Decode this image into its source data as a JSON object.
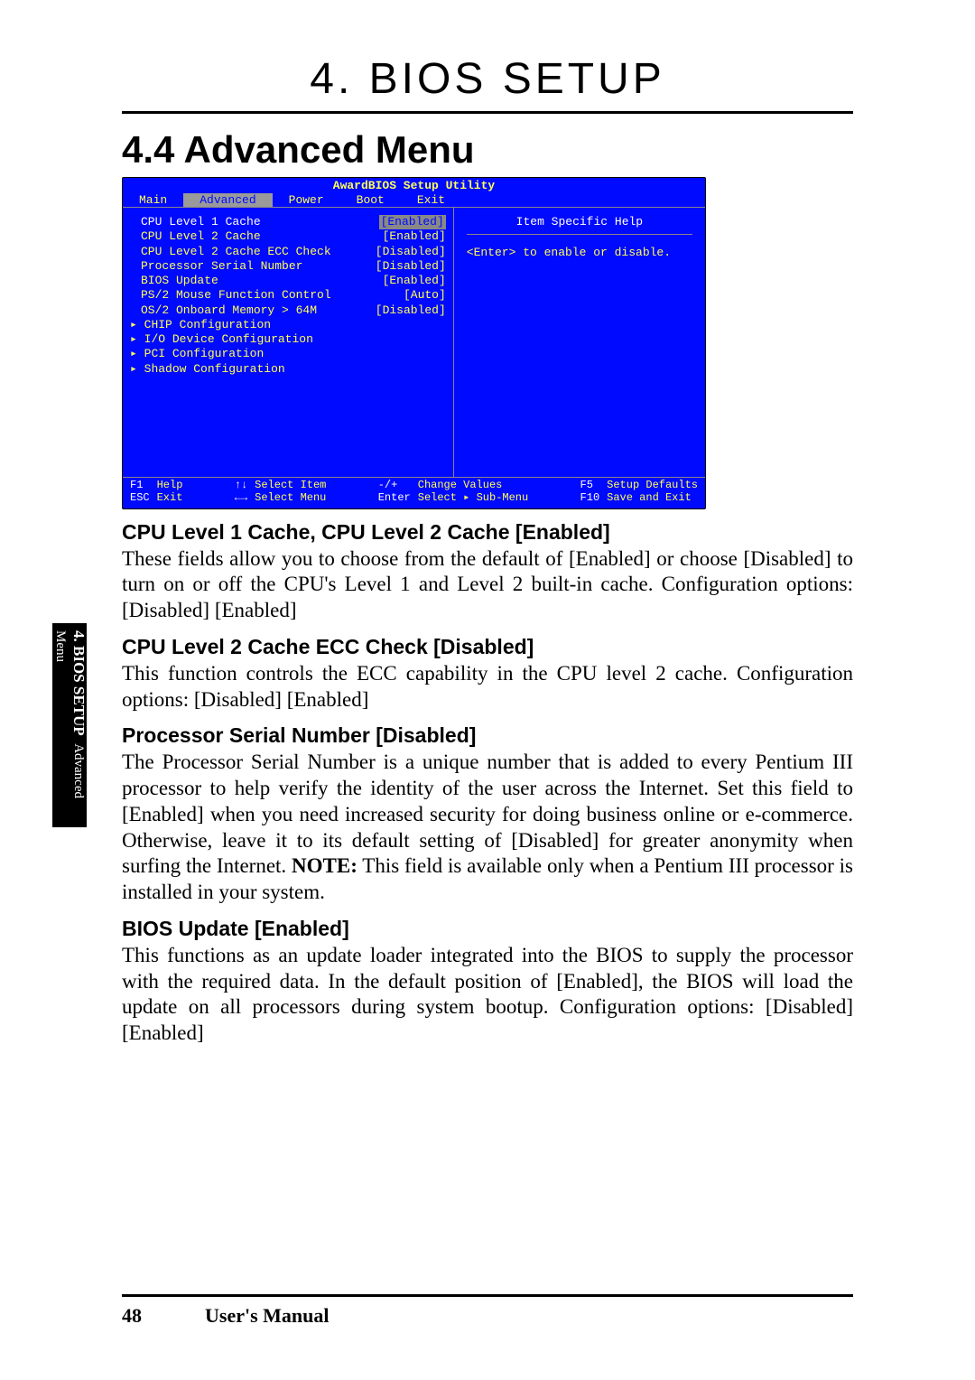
{
  "page_title": "4. BIOS SETUP",
  "section_title": "4.4  Advanced Menu",
  "bios": {
    "header": "AwardBIOS Setup Utility",
    "menu": [
      "Main",
      "Advanced",
      "Power",
      "Boot",
      "Exit"
    ],
    "active_menu_index": 1,
    "items": [
      {
        "label": "CPU Level 1 Cache",
        "value": "[Enabled]",
        "selected": true
      },
      {
        "label": "CPU Level 2 Cache",
        "value": "[Enabled]"
      },
      {
        "label": "CPU Level 2 Cache ECC Check",
        "value": "[Disabled]"
      },
      {
        "label": "Processor Serial Number",
        "value": "[Disabled]"
      },
      {
        "label": "BIOS Update",
        "value": "[Enabled]"
      },
      {
        "label": "PS/2 Mouse Function Control",
        "value": "[Auto]"
      },
      {
        "label": "OS/2 Onboard Memory > 64M",
        "value": "[Disabled]"
      },
      {
        "label": "CHIP Configuration",
        "submenu": true
      },
      {
        "label": "I/O Device Configuration",
        "submenu": true
      },
      {
        "label": "PCI Configuration",
        "submenu": true
      },
      {
        "label": "Shadow Configuration",
        "submenu": true
      }
    ],
    "help_title": "Item Specific Help",
    "help_text": "<Enter> to enable or disable.",
    "footer": {
      "f1": "F1",
      "help": "Help",
      "esc": "ESC",
      "exit": "Exit",
      "updown": "↑↓",
      "select_item": "Select Item",
      "leftright": "←→",
      "select_menu": "Select Menu",
      "plusminus": "-/+",
      "change_values": "Change Values",
      "enter": "Enter",
      "select_sub": "Select ▸ Sub-Menu",
      "f5": "F5",
      "setup_defaults": "Setup Defaults",
      "f10": "F10",
      "save_exit": "Save and Exit"
    }
  },
  "sections": [
    {
      "heading": "CPU Level 1 Cache, CPU Level 2 Cache [Enabled]",
      "body": "These fields allow you to choose from the default of [Enabled] or choose [Disabled] to turn on or off the CPU's Level 1 and Level 2 built-in cache. Configuration options: [Disabled] [Enabled]"
    },
    {
      "heading": "CPU Level 2 Cache ECC Check [Disabled]",
      "body": "This function controls the ECC capability in the CPU level 2 cache. Configuration options: [Disabled] [Enabled]"
    },
    {
      "heading": "Processor Serial Number [Disabled]",
      "body_html": "The Processor Serial Number is a unique number that is added to every Pentium III processor to help verify the identity of the user across the Internet. Set this field to [Enabled] when you need increased security for doing business online or e-commerce. Otherwise, leave it to its default setting of [Disabled] for greater anonymity when surfing the Internet. <span class=\"note-bold\">NOTE:</span> This field is available only when a Pentium III processor is installed in your system."
    },
    {
      "heading": "BIOS Update [Enabled]",
      "body": "This functions as an update loader integrated into the BIOS to supply the processor with the required data. In the default position of [Enabled], the BIOS will load the update on all processors during system bootup. Configuration options: [Disabled] [Enabled]"
    }
  ],
  "side_tab": {
    "line1": "4. BIOS SETUP",
    "line2": "Advanced Menu"
  },
  "footer": {
    "page": "48",
    "label": "User's Manual"
  }
}
